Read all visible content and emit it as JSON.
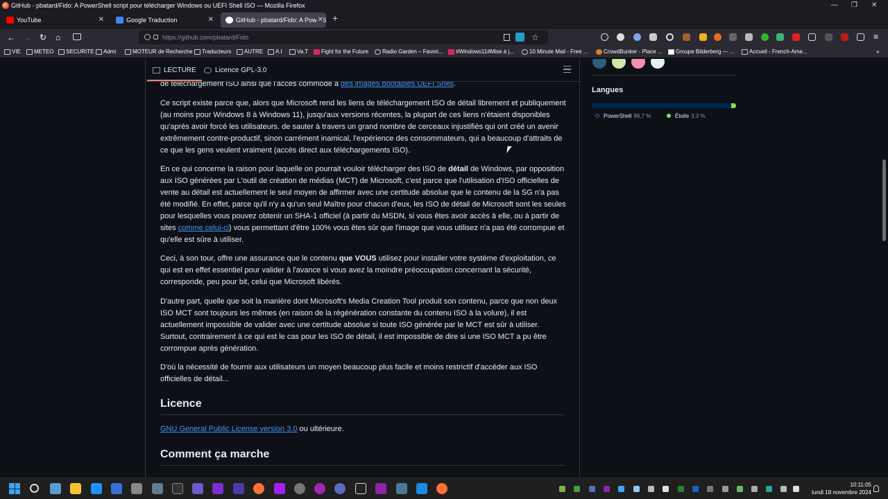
{
  "window": {
    "title": "GitHub - pbatard/Fido: A PowerShell script pour télécharger Windows ou UEFI Shell ISO — Mozilla Firefox",
    "controls": [
      "—",
      "❐",
      "✕"
    ]
  },
  "tabs": [
    {
      "label": "YouTube",
      "icon": "youtube-icon",
      "color": "#ff0000",
      "active": false
    },
    {
      "label": "Google Traduction",
      "icon": "google-translate-icon",
      "color": "#4285f4",
      "active": false
    },
    {
      "label": "GitHub - pbatard/Fido: A PowerS",
      "icon": "github-icon",
      "color": "#ffffff",
      "active": true
    }
  ],
  "newtab_label": "+",
  "nav": {
    "back": "←",
    "forward": "→",
    "reload": "↻",
    "home": "⌂",
    "url": "https://github.com/pbatard/Fido"
  },
  "bookmarks": [
    {
      "label": "VIE",
      "icon": "folder-icon"
    },
    {
      "label": "METEO",
      "icon": "folder-icon"
    },
    {
      "label": "SECURITE",
      "icon": "folder-icon"
    },
    {
      "label": "Admi",
      "icon": "folder-icon"
    },
    {
      "label": "MOTEUR de Recherche",
      "icon": "folder-icon"
    },
    {
      "label": "Traducteurs",
      "icon": "folder-icon"
    },
    {
      "label": "AUTRE",
      "icon": "folder-icon"
    },
    {
      "label": "A.I",
      "icon": "folder-icon"
    },
    {
      "label": "Va.T",
      "icon": "folder-icon"
    },
    {
      "label": "Fight for the Future",
      "icon": "shield-icon"
    },
    {
      "label": "Radio Garden – Favori...",
      "icon": "globe-icon"
    },
    {
      "label": "#Windows11#Mise à j...",
      "icon": "youtube-icon"
    },
    {
      "label": "10 Minute Mail - Free ...",
      "icon": "globe-icon"
    },
    {
      "label": "CrowdBunker - Place ...",
      "icon": "crowdbunker-icon"
    },
    {
      "label": "Groupe Bilderberg — ...",
      "icon": "wikipedia-icon"
    },
    {
      "label": "Accueil - French-Ame...",
      "icon": "page-icon"
    }
  ],
  "readme_tabs": {
    "lecture": "LECTURE",
    "licence": "Licence GPL-3.0"
  },
  "readme": {
    "p0_partial_text": "de téléchargement ISO ainsi que l'accès commode à ",
    "p0_partial_link": "des images bootables UEFI Shell",
    "p0_partial_end": ".",
    "p1": "Ce script existe parce que, alors que Microsoft rend les liens de téléchargement ISO de détail librement et publiquement (au moins pour Windows 8 à Windows 11), jusqu'aux versions récentes, la plupart de ces liens n'étaient disponibles qu'après avoir forcé les utilisateurs. de sauter à travers un grand nombre de cerceaux injustifiés qui ont créé un avenir extrêmement contre-productif, sinon carrément inamical, l'expérience des consommateurs, qui a beaucoup d'attraits de ce que les gens veulent vraiment (accès direct aux téléchargements ISO).",
    "p2_a": "En ce qui concerne la raison pour laquelle on pourrait vouloir télécharger des ISO de ",
    "p2_bold": "détail",
    "p2_b": " de Windows, par opposition aux ISO générées par L'outil de création de médias (MCT) de Microsoft, c'est parce que l'utilisation d'ISO officielles de vente au détail est actuellement le seul moyen de affirmer avec une certitude absolue que le contenu de la SG n'a pas été modifié. En effet, parce qu'il n'y a qu'un seul Maître pour chacun d'eux, les ISO de détail de Microsoft sont les seules pour lesquelles vous pouvez obtenir un SHA-1 officiel (à partir du MSDN, si vous êtes avoir accès à elle, ou à partir de sites ",
    "p2_link": "comme celui-ci",
    "p2_c": ") vous permettant d'être 100% vous êtes sûr que l'image que vous utilisez n'a pas été corrompue et qu'elle est sûre à utiliser.",
    "p3_a": "Ceci, à son tour, offre une assurance que le contenu ",
    "p3_bold": "que VOUS",
    "p3_b": " utilisez pour installer votre système d'exploitation, ce qui est en effet essentiel pour valider à l'avance si vous avez la moindre préoccupation concernant la sécurité, corresponde, peu pour bit, celui que Microsoft libérés.",
    "p4": "D'autre part, quelle que soit la manière dont Microsoft's Media Creation Tool produit son contenu, parce que non deux ISO MCT sont toujours les mêmes (en raison de la régénération constante du contenu ISO à la volure), il est actuellement impossible de valider avec une certitude absolue si toute ISO générée par le MCT est sûr à utiliser. Surtout, contrairement à ce qui est le cas pour les ISO de détail, il est impossible de dire si une ISO MCT a pu être corrompue après génération.",
    "p5": "D'où la nécessité de fournir aux utilisateurs un moyen beaucoup plus facile et moins restrictif d'accéder aux ISO officielles de détail...",
    "h_licence": "Licence",
    "licence_link": "GNU General Public License version 3.0",
    "licence_rest": " ou ultérieure.",
    "h_comment": "Comment ça marche"
  },
  "sidebar": {
    "languages_title": "Langues",
    "languages": [
      {
        "name": "PowerShell",
        "pct": "96,7 %",
        "value": 96.7,
        "color": "#012456"
      },
      {
        "name": "Étoile",
        "pct": "3,3 %",
        "value": 3.3,
        "color": "#89e051"
      }
    ]
  },
  "taskbar": {
    "clock_time": "10:11:05",
    "clock_date": "lundi 18 novembre 2024"
  }
}
